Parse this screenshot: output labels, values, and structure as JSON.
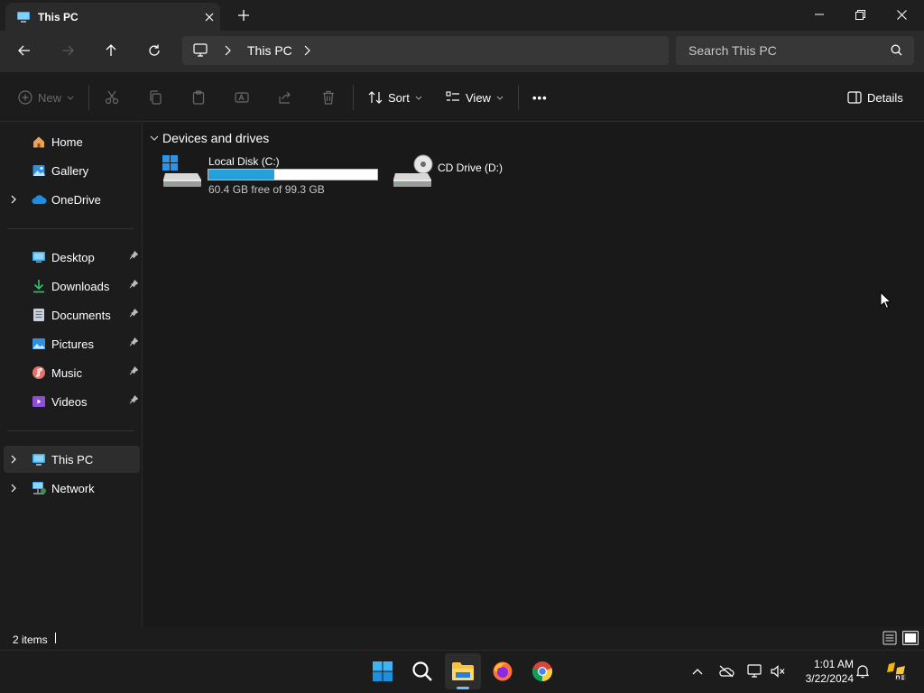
{
  "window": {
    "tab_title": "This PC",
    "new_tab_symbol": "+"
  },
  "address": {
    "breadcrumb": [
      "This PC"
    ],
    "search_placeholder": "Search This PC"
  },
  "toolbar": {
    "new_label": "New",
    "sort_label": "Sort",
    "view_label": "View",
    "more_label": "•••",
    "details_label": "Details"
  },
  "sidebar": {
    "quick": [
      {
        "label": "Home",
        "icon": "home-icon"
      },
      {
        "label": "Gallery",
        "icon": "gallery-icon"
      },
      {
        "label": "OneDrive",
        "icon": "onedrive-icon"
      }
    ],
    "pinned": [
      {
        "label": "Desktop",
        "icon": "desktop-icon"
      },
      {
        "label": "Downloads",
        "icon": "downloads-icon"
      },
      {
        "label": "Documents",
        "icon": "documents-icon"
      },
      {
        "label": "Pictures",
        "icon": "pictures-icon"
      },
      {
        "label": "Music",
        "icon": "music-icon"
      },
      {
        "label": "Videos",
        "icon": "videos-icon"
      }
    ],
    "locations": [
      {
        "label": "This PC",
        "icon": "this-pc-icon",
        "selected": true
      },
      {
        "label": "Network",
        "icon": "network-icon"
      }
    ]
  },
  "content": {
    "group_title": "Devices and drives",
    "drives": [
      {
        "name": "Local Disk (C:)",
        "free_text": "60.4 GB free of 99.3 GB",
        "used_fraction": 0.392
      },
      {
        "name": "CD Drive (D:)"
      }
    ]
  },
  "status": {
    "item_count": "2 items"
  },
  "taskbar": {
    "time": "1:01 AM",
    "date": "3/22/2024"
  },
  "colors": {
    "accent": "#26a0da",
    "background": "#191919",
    "panel": "#1c1c1c"
  }
}
